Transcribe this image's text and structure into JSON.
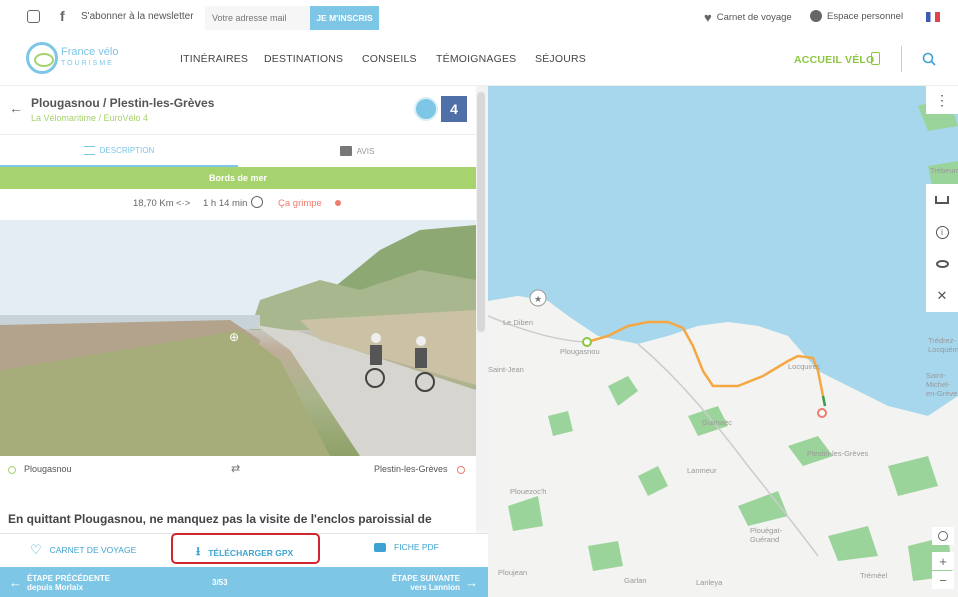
{
  "topbar": {
    "newsletter_text": "S'abonner à la newsletter",
    "email_placeholder": "Votre adresse mail",
    "subscribe_label": "JE M'INSCRIS",
    "carnet_label": "Carnet de voyage",
    "espace_label": "Espace personnel"
  },
  "header": {
    "logo_main": "France vélo",
    "logo_sub": "TOURISME",
    "nav": [
      "ITINÉRAIRES",
      "DESTINATIONS",
      "CONSEILS",
      "TÉMOIGNAGES",
      "SÉJOURS"
    ],
    "accueil_label": "ACCUEIL VÉLO"
  },
  "stage": {
    "title": "Plougasnou / Plestin-les-Grèves",
    "subtitle": "La Vélomaritime / EuroVélo 4",
    "eurovelo_number": "4",
    "tabs": {
      "description": "DESCRIPTION",
      "avis": "AVIS"
    },
    "banner": "Bords de mer",
    "distance": "18,70 Km",
    "duration": "1 h 14 min",
    "difficulty": "Ça grimpe",
    "start": "Plougasnou",
    "end": "Plestin-les-Grèves",
    "body": "En quittant Plougasnou, ne manquez pas la visite de l'enclos paroissial de Saint-"
  },
  "actions": {
    "carnet": "CARNET DE VOYAGE",
    "gpx": "TÉLÉCHARGER GPX",
    "pdf": "FICHE PDF"
  },
  "stepbar": {
    "prev_title": "ÉTAPE PRÉCÉDENTE",
    "prev_sub": "depuis Morlaix",
    "counter": "3/53",
    "next_title": "ÉTAPE SUIVANTE",
    "next_sub": "vers Lannion"
  },
  "map": {
    "labels": [
      "Le Diben",
      "Plougasnou",
      "Saint-Jean",
      "Locquirec",
      "Guimaëc",
      "Lanmeur",
      "Plestin-les-Grèves",
      "Plouezoc'h",
      "Plouégat-Guérand",
      "Garlan",
      "Lanleya",
      "Tréméel",
      "Ploujean",
      "Trédrez-Locquémeau",
      "Saint-Michel-en-Grève",
      "Trébeurd"
    ]
  },
  "colors": {
    "accent_blue": "#7dc6e6",
    "accent_green": "#a6d36d",
    "route_orange": "#f4a742",
    "highlight_red": "#d0262d"
  }
}
